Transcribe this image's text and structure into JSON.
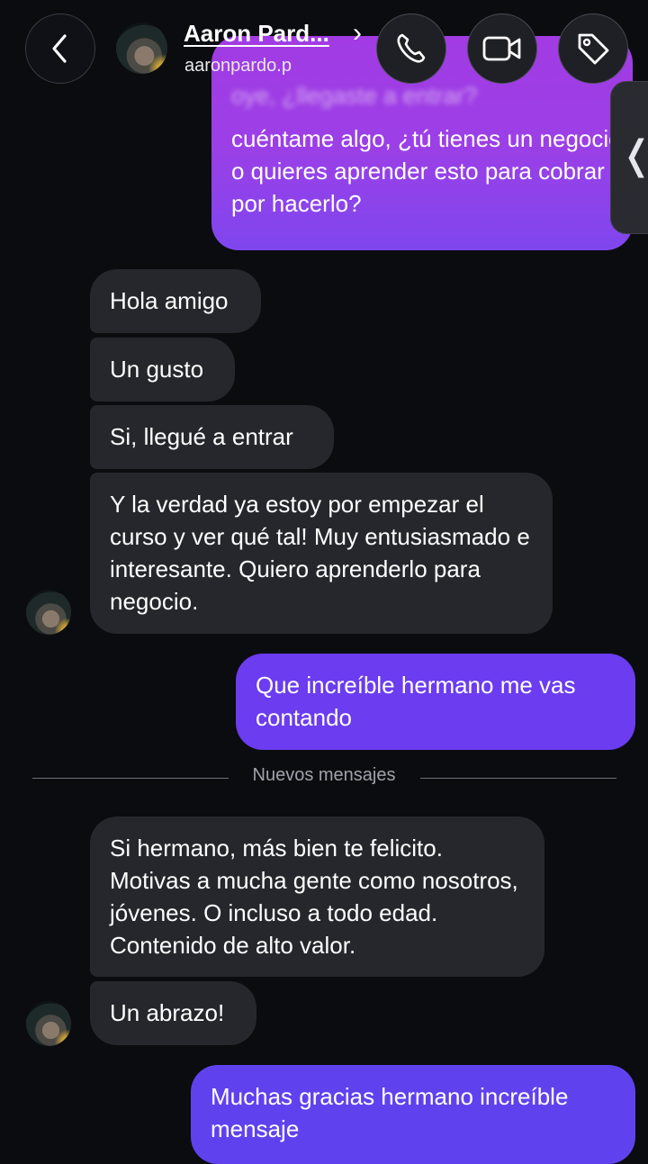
{
  "header": {
    "contact_name": "Aaron Pard...",
    "contact_handle": "aaronpardo.p",
    "chevron": "›",
    "back_icon": "chevron-left-icon",
    "call_icon": "phone-icon",
    "video_icon": "video-camera-icon",
    "tag_icon": "tag-icon"
  },
  "colors": {
    "background": "#0b0c10",
    "incoming_bubble": "#26272d",
    "outgoing_bubble": "#6b3cf0",
    "outgoing_gradient_top": "#a23be4"
  },
  "messages": {
    "partial_top_text": "oye, ¿llegaste a entrar?",
    "m1": "cuéntame algo, ¿tú tienes un negocio o quieres aprender esto para cobrar por hacerlo?",
    "m2": "Hola amigo",
    "m3": "Un gusto",
    "m4": "Si, llegué a entrar",
    "m5": "Y la verdad ya estoy por empezar el curso y ver qué tal! Muy entusiasmado e interesante. Quiero aprenderlo para negocio.",
    "m6": "Que increíble hermano me vas contando",
    "m7": "Si hermano, más bien te felicito. Motivas a mucha gente como nosotros, jóvenes. O incluso a todo edad. Contenido de alto valor.",
    "m8": "Un abrazo!",
    "m9": "Muchas gracias hermano increíble mensaje"
  },
  "divider_label": "Nuevos mensajes",
  "side_tab_glyph": "❬"
}
